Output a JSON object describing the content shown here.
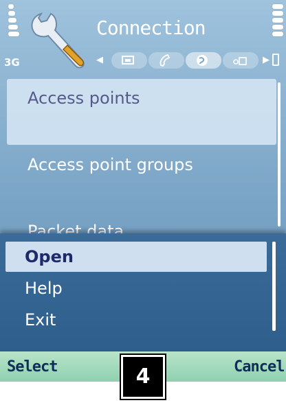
{
  "header": {
    "network": "3G",
    "title": "Connection",
    "tabs": [
      {
        "icon": "device-icon",
        "active": false
      },
      {
        "icon": "phone-icon",
        "active": false
      },
      {
        "icon": "globe-icon",
        "active": true
      },
      {
        "icon": "data-icon",
        "active": false
      }
    ]
  },
  "list": {
    "items": [
      {
        "label": "Access points",
        "selected": true
      },
      {
        "label": "Access point groups",
        "selected": false
      },
      {
        "label": "Packet data",
        "selected": false
      }
    ]
  },
  "menu": {
    "items": [
      {
        "label": "Open",
        "highlighted": true
      },
      {
        "label": "Help",
        "highlighted": false
      },
      {
        "label": "Exit",
        "highlighted": false
      }
    ]
  },
  "softkeys": {
    "left": "Select",
    "right": "Cancel"
  },
  "badge": "4",
  "colors": {
    "header_text": "#ffffff",
    "selected_row": "#d7e8f6",
    "menu_bg": "#2e5f8c",
    "menu_highlight": "#d0dff0",
    "softkey_bar": "#a5dabc",
    "softkey_text": "#0e2f58"
  }
}
